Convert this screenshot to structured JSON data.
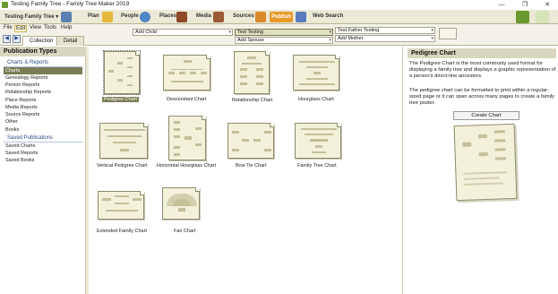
{
  "window": {
    "title": "Testing Family Tree - Family Tree Maker 2019"
  },
  "toolbar": {
    "tree_name": "Testing Family Tree",
    "tabs": [
      {
        "label": "Plan",
        "icon": "home-icon"
      },
      {
        "label": "People",
        "icon": "people-icon"
      },
      {
        "label": "Places",
        "icon": "globe-icon"
      },
      {
        "label": "Media",
        "icon": "books-icon"
      },
      {
        "label": "Sources",
        "icon": "bookshelf-icon"
      },
      {
        "label": "Publish",
        "icon": "printer-icon"
      },
      {
        "label": "Web Search",
        "icon": "web-icon"
      }
    ]
  },
  "menu": {
    "items": [
      "File",
      "Edit",
      "View",
      "Tools",
      "Help"
    ]
  },
  "nav": {
    "tabs": [
      "Collection",
      "Detail"
    ],
    "family": {
      "add_child": "Add Child",
      "selected": "Test Testing",
      "add_spouse": "Add Spouse",
      "father": "Test Father Testing",
      "add_mother": "Add Mother"
    }
  },
  "left_panel": {
    "title": "Publication Types",
    "sections": [
      {
        "label": "Charts & Reports",
        "items": [
          "Charts",
          "Genealogy Reports",
          "Person Reports",
          "Relationship Reports",
          "Place Reports",
          "Media Reports",
          "Source Reports",
          "Other",
          "Books"
        ]
      },
      {
        "label": "Saved Publications",
        "items": [
          "Saved Charts",
          "Saved Reports",
          "Saved Books"
        ]
      }
    ],
    "selected_item": "Charts"
  },
  "charts": [
    {
      "label": "Pedigree Chart"
    },
    {
      "label": "Descendant Chart"
    },
    {
      "label": "Relationship Chart"
    },
    {
      "label": "Hourglass Chart"
    },
    {
      "label": "Vertical Pedigree Chart"
    },
    {
      "label": "Horizontal Hourglass Chart"
    },
    {
      "label": "Bow Tie Chart"
    },
    {
      "label": "Family Tree Chart"
    },
    {
      "label": "Extended Family Chart"
    },
    {
      "label": "Fan Chart"
    }
  ],
  "right_panel": {
    "title": "Pedigree Chart",
    "description_1": "The Pedigree Chart is the most commonly used format for displaying a family tree and displays a graphic representation of a person's direct-line ancestors.",
    "description_2": "The pedigree chart can be formatted to print within a regular-sized page or it can span across many pages to create a family tree poster.",
    "create_button": "Create Chart"
  },
  "colors": {
    "accent": "#7b7b55",
    "publish": "#e69a2a",
    "panel_header": "#d9d6c0"
  }
}
